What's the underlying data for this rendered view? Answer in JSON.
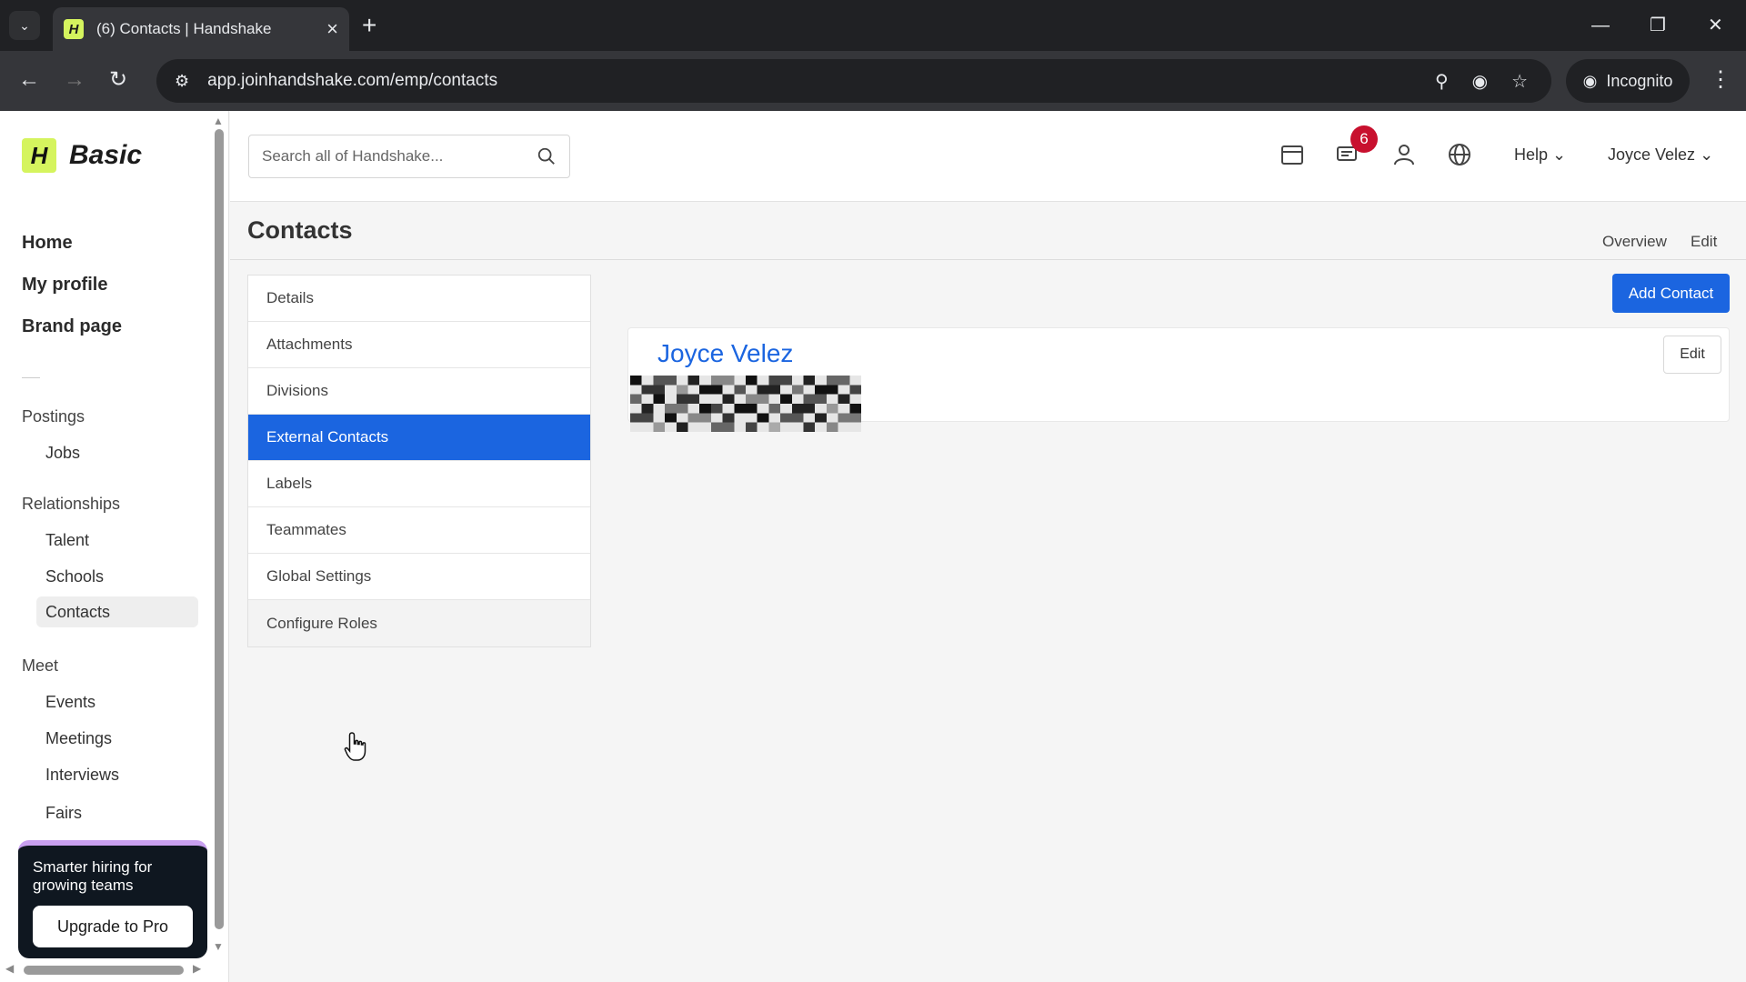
{
  "browser": {
    "tab_title": "(6) Contacts | Handshake",
    "favicon_letter": "H",
    "url": "app.joinhandshake.com/emp/contacts",
    "incognito_label": "Incognito"
  },
  "sidebar": {
    "brand_letter": "H",
    "brand_name": "Basic",
    "primary": [
      "Home",
      "My profile",
      "Brand page"
    ],
    "sections": {
      "postings": "Postings",
      "jobs": "Jobs",
      "relationships": "Relationships",
      "talent": "Talent",
      "schools": "Schools",
      "contacts": "Contacts",
      "meet": "Meet",
      "events": "Events",
      "meetings": "Meetings",
      "interviews": "Interviews",
      "fairs": "Fairs"
    },
    "promo": {
      "text": "Smarter hiring for growing teams",
      "button": "Upgrade to Pro"
    }
  },
  "header": {
    "search_placeholder": "Search all of Handshake...",
    "notification_count": "6",
    "help": "Help",
    "user": "Joyce Velez"
  },
  "page": {
    "title": "Contacts",
    "tabs": [
      "Overview",
      "Edit"
    ],
    "menu": [
      "Details",
      "Attachments",
      "Divisions",
      "External Contacts",
      "Labels",
      "Teammates",
      "Global Settings",
      "Configure Roles"
    ],
    "active_menu": "External Contacts",
    "add_button": "Add Contact",
    "contact": {
      "name": "Joyce Velez",
      "edit": "Edit"
    }
  },
  "colors": {
    "accent": "#1b65e0",
    "brand": "#d5f45e",
    "badge": "#c8102e"
  }
}
